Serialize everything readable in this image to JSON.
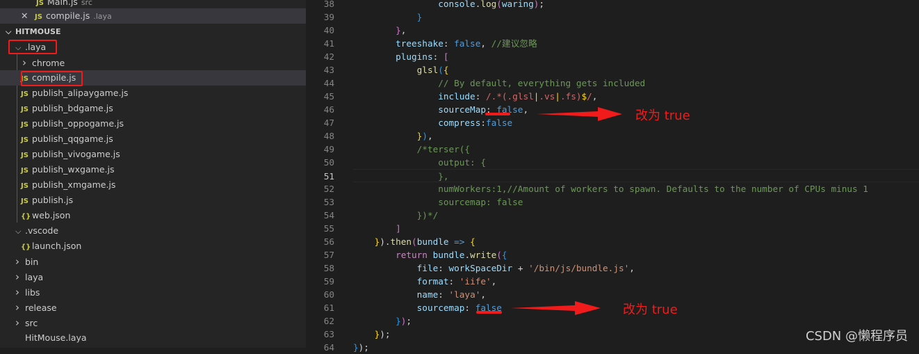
{
  "open_editors": [
    {
      "label": "Main.js",
      "desc": "src",
      "icon": "js-file-icon",
      "close": false
    },
    {
      "label": "compile.js",
      "desc": ".laya",
      "icon": "js-file-icon",
      "close": true
    }
  ],
  "workspace": {
    "title": "HITMOUSE"
  },
  "tree": [
    {
      "label": ".laya",
      "type": "folder-open",
      "depth": 0
    },
    {
      "label": "chrome",
      "type": "folder",
      "depth": 1
    },
    {
      "label": "compile.js",
      "type": "js",
      "depth": 1,
      "selected": true
    },
    {
      "label": "publish_alipaygame.js",
      "type": "js",
      "depth": 1
    },
    {
      "label": "publish_bdgame.js",
      "type": "js",
      "depth": 1
    },
    {
      "label": "publish_oppogame.js",
      "type": "js",
      "depth": 1
    },
    {
      "label": "publish_qqgame.js",
      "type": "js",
      "depth": 1
    },
    {
      "label": "publish_vivogame.js",
      "type": "js",
      "depth": 1
    },
    {
      "label": "publish_wxgame.js",
      "type": "js",
      "depth": 1
    },
    {
      "label": "publish_xmgame.js",
      "type": "js",
      "depth": 1
    },
    {
      "label": "publish.js",
      "type": "js",
      "depth": 1
    },
    {
      "label": "web.json",
      "type": "json",
      "depth": 1
    },
    {
      "label": ".vscode",
      "type": "folder-open",
      "depth": 0
    },
    {
      "label": "launch.json",
      "type": "json",
      "depth": 1
    },
    {
      "label": "bin",
      "type": "folder",
      "depth": 0
    },
    {
      "label": "laya",
      "type": "folder",
      "depth": 0
    },
    {
      "label": "libs",
      "type": "folder",
      "depth": 0
    },
    {
      "label": "release",
      "type": "folder",
      "depth": 0
    },
    {
      "label": "src",
      "type": "folder",
      "depth": 0
    },
    {
      "label": "HitMouse.laya",
      "type": "file",
      "depth": 0
    }
  ],
  "code": [
    {
      "n": "38",
      "i": 4,
      "t": [
        [
          "console",
          "k"
        ],
        [
          ".",
          "w"
        ],
        [
          "log",
          "f"
        ],
        [
          "(",
          "p"
        ],
        [
          "waring",
          "k"
        ],
        [
          ")",
          "p"
        ],
        [
          ";",
          "w"
        ]
      ]
    },
    {
      "n": "39",
      "i": 3,
      "t": [
        [
          "}",
          "bb"
        ]
      ]
    },
    {
      "n": "40",
      "i": 2,
      "t": [
        [
          "}",
          "p"
        ],
        [
          ",",
          "w"
        ]
      ]
    },
    {
      "n": "41",
      "i": 2,
      "t": [
        [
          "treeshake",
          "k"
        ],
        [
          ": ",
          "w"
        ],
        [
          "false",
          "b"
        ],
        [
          ", ",
          "w"
        ],
        [
          "//建议忽略",
          "c"
        ]
      ]
    },
    {
      "n": "42",
      "i": 2,
      "t": [
        [
          "plugins",
          "k"
        ],
        [
          ": ",
          "w"
        ],
        [
          "[",
          "p"
        ]
      ]
    },
    {
      "n": "43",
      "i": 3,
      "t": [
        [
          "glsl",
          "f"
        ],
        [
          "(",
          "bb"
        ],
        [
          "{",
          "y"
        ]
      ]
    },
    {
      "n": "44",
      "i": 4,
      "t": [
        [
          "// By default, everything gets included",
          "c"
        ]
      ]
    },
    {
      "n": "45",
      "i": 4,
      "t": [
        [
          "include",
          "k"
        ],
        [
          ": ",
          "w"
        ],
        [
          "/.*(.glsl",
          "r"
        ],
        [
          "|",
          "y"
        ],
        [
          ".vs",
          "r"
        ],
        [
          "|",
          "y"
        ],
        [
          ".fs)",
          "r"
        ],
        [
          "$",
          "y"
        ],
        [
          "/",
          "r"
        ],
        [
          ",",
          "w"
        ]
      ]
    },
    {
      "n": "46",
      "i": 4,
      "t": [
        [
          "sourceMap",
          "k"
        ],
        [
          ": ",
          "w"
        ],
        [
          "false",
          "b"
        ],
        [
          ",",
          "w"
        ]
      ]
    },
    {
      "n": "47",
      "i": 4,
      "t": [
        [
          "compress",
          "k"
        ],
        [
          ":",
          "w"
        ],
        [
          "false",
          "b"
        ]
      ]
    },
    {
      "n": "48",
      "i": 3,
      "t": [
        [
          "}",
          "y"
        ],
        [
          ")",
          "bb"
        ],
        [
          ",",
          "w"
        ]
      ]
    },
    {
      "n": "49",
      "i": 3,
      "t": [
        [
          "/*terser({",
          "c"
        ]
      ]
    },
    {
      "n": "50",
      "i": 4,
      "t": [
        [
          "output: {",
          "c"
        ]
      ]
    },
    {
      "n": "51",
      "i": 4,
      "t": [
        [
          "},",
          "c"
        ]
      ],
      "cur": true
    },
    {
      "n": "52",
      "i": 4,
      "t": [
        [
          "numWorkers:1,//Amount of workers to spawn. Defaults to the number of CPUs minus 1",
          "c"
        ]
      ]
    },
    {
      "n": "53",
      "i": 4,
      "t": [
        [
          "sourcemap: false",
          "c"
        ]
      ]
    },
    {
      "n": "54",
      "i": 3,
      "t": [
        [
          "})*/",
          "c"
        ]
      ]
    },
    {
      "n": "55",
      "i": 2,
      "t": [
        [
          "]",
          "p"
        ]
      ]
    },
    {
      "n": "56",
      "i": 1,
      "t": [
        [
          "}",
          "y"
        ],
        [
          ").",
          "w"
        ],
        [
          "then",
          "f"
        ],
        [
          "(",
          "p"
        ],
        [
          "bundle",
          "k"
        ],
        [
          " => ",
          "b"
        ],
        [
          "{",
          "y"
        ]
      ]
    },
    {
      "n": "57",
      "i": 2,
      "t": [
        [
          "return ",
          "kw"
        ],
        [
          "bundle",
          "k"
        ],
        [
          ".",
          "w"
        ],
        [
          "write",
          "f"
        ],
        [
          "(",
          "p"
        ],
        [
          "{",
          "bb"
        ]
      ]
    },
    {
      "n": "58",
      "i": 3,
      "t": [
        [
          "file",
          "k"
        ],
        [
          ": ",
          "w"
        ],
        [
          "workSpaceDir",
          "k"
        ],
        [
          " + ",
          "w"
        ],
        [
          "'/bin/js/bundle.js'",
          "s"
        ],
        [
          ",",
          "w"
        ]
      ]
    },
    {
      "n": "59",
      "i": 3,
      "t": [
        [
          "format",
          "k"
        ],
        [
          ": ",
          "w"
        ],
        [
          "'iife'",
          "s"
        ],
        [
          ",",
          "w"
        ]
      ]
    },
    {
      "n": "60",
      "i": 3,
      "t": [
        [
          "name",
          "k"
        ],
        [
          ": ",
          "w"
        ],
        [
          "'laya'",
          "s"
        ],
        [
          ",",
          "w"
        ]
      ]
    },
    {
      "n": "61",
      "i": 3,
      "t": [
        [
          "sourcemap",
          "k"
        ],
        [
          ": ",
          "w"
        ],
        [
          "false",
          "b"
        ]
      ]
    },
    {
      "n": "62",
      "i": 2,
      "t": [
        [
          "}",
          "bb"
        ],
        [
          ")",
          "p"
        ],
        [
          ";",
          "w"
        ]
      ]
    },
    {
      "n": "63",
      "i": 1,
      "t": [
        [
          "}",
          "y"
        ],
        [
          ");",
          "w"
        ]
      ]
    },
    {
      "n": "64",
      "i": 0,
      "t": [
        [
          "}",
          "bb"
        ],
        [
          ");",
          "w"
        ]
      ]
    }
  ],
  "annotations": {
    "note1": "改为 true",
    "note2": "改为 true",
    "color": "#f21b1b"
  },
  "watermark": "CSDN @懒程序员"
}
